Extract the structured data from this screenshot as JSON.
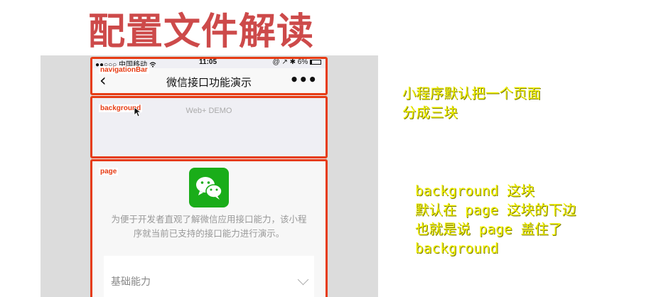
{
  "slide": {
    "title": "配置文件解读",
    "title_color": "#cd4a4a"
  },
  "phone": {
    "status_bar": {
      "carrier": "●●○○○ 中国移动 ",
      "wifi_icon": "wifi-icon",
      "time": "11:05",
      "battery": "6%",
      "right_icons": "@ ↗ ✱"
    },
    "nav": {
      "back_icon": "chevron-left-icon",
      "back_glyph": "‹",
      "title": "微信接口功能演示",
      "more_glyph": "•••"
    },
    "background_text": "Web+ DEMO",
    "page": {
      "logo_icon": "wechat-logo-icon",
      "description_line1": "为便于开发者直观了解微信应用接口能力，该小程",
      "description_line2": "序就当前已支持的接口能力进行演示。",
      "list_item_label": "基础能力"
    }
  },
  "annotations": {
    "navigation_bar_label": "navigationBar",
    "background_label": "background",
    "page_label": "page",
    "color": "#e63c14"
  },
  "notes": {
    "note1_line1": "小程序默认把一个页面",
    "note1_line2": "分成三块",
    "note2_line1": "background 这块",
    "note2_line2": "默认在 page 这块的下边",
    "note2_line3": "也就是说 page 盖住了",
    "note2_line4": "background",
    "color": "#f2f200"
  }
}
